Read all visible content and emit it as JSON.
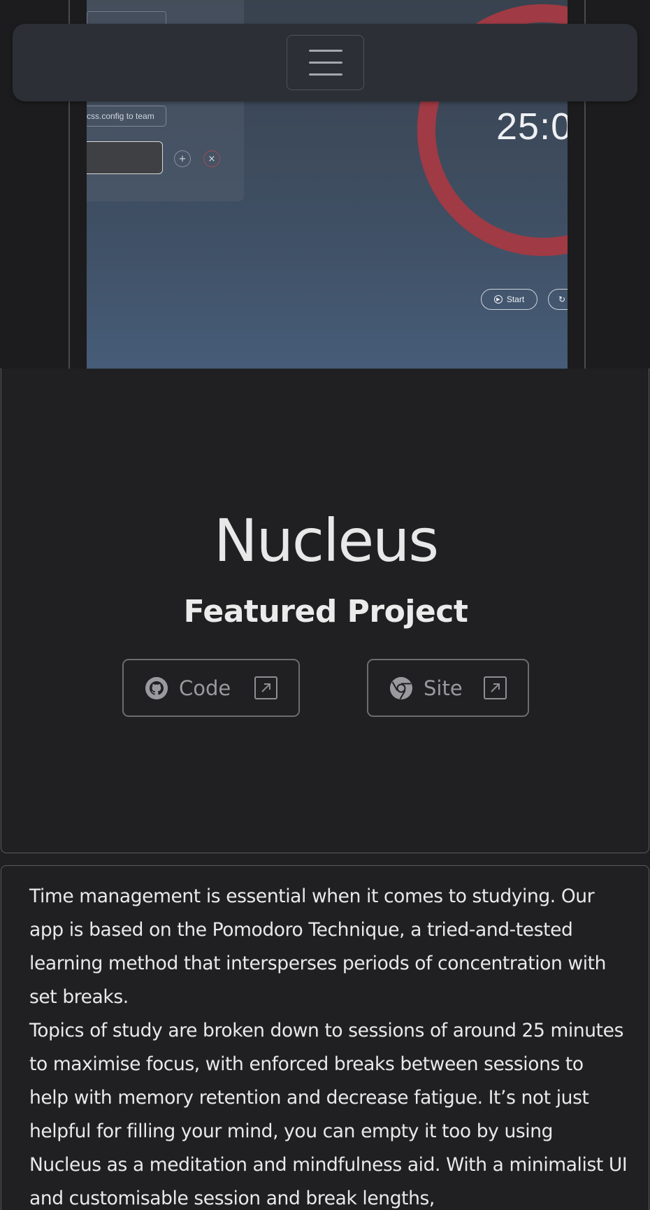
{
  "preview": {
    "chip_text": "css.config to team",
    "timer": "25:0",
    "start_label": "Start",
    "add_icon": "plus-circle-icon",
    "remove_icon": "x-circle-icon",
    "reset_icon": "refresh-icon",
    "accent_color": "#a03a44"
  },
  "navbar": {
    "menu_icon": "hamburger-menu-icon"
  },
  "feature": {
    "title": "Nucleus",
    "subtitle": "Featured Project",
    "buttons": [
      {
        "label": "Code",
        "icon": "github-icon",
        "ext_icon": "external-link-icon"
      },
      {
        "label": "Site",
        "icon": "chrome-icon",
        "ext_icon": "external-link-icon"
      }
    ]
  },
  "description": {
    "paragraphs": [
      "Time management is essential when it comes to studying. Our app is based on the Pomodoro Technique, a tried-and-tested learning method that intersperses periods of concentration with set breaks.",
      "Topics of study are broken down to sessions of around 25 minutes to maximise focus, with enforced breaks between sessions to help with memory retention and decrease fatigue. It’s not just helpful for filling your mind, you can empty it too by using Nucleus as a meditation and mindfulness aid. With a minimalist UI and customisable session and break lengths,"
    ]
  }
}
